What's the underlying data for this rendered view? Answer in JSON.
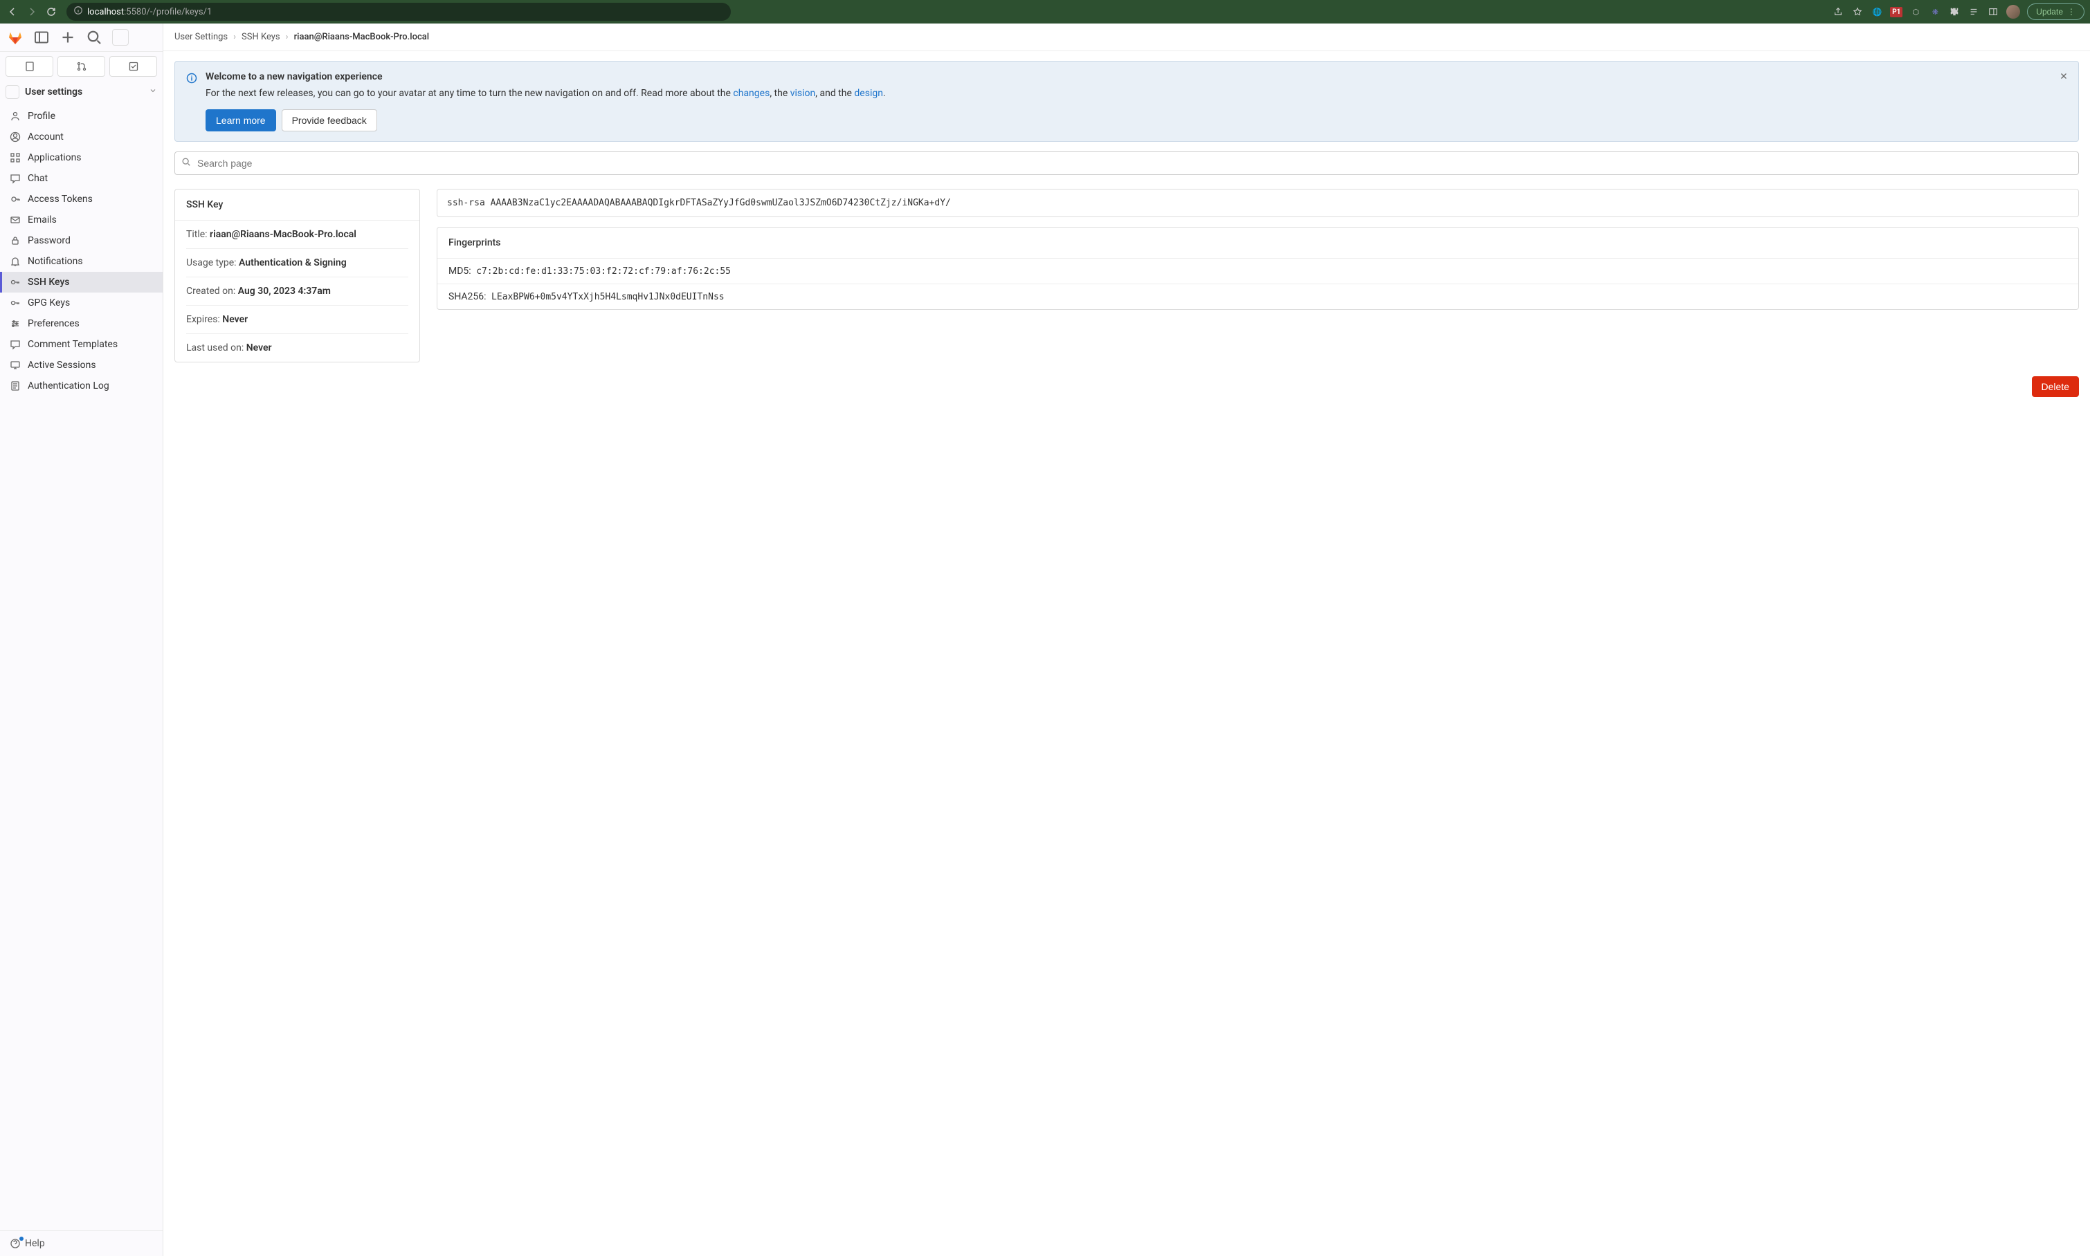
{
  "browser": {
    "url_host": "localhost",
    "url_port_path": ":5580/-/profile/keys/1",
    "update_label": "Update"
  },
  "sidebar": {
    "section_title": "User settings",
    "items": [
      {
        "icon": "profile",
        "label": "Profile"
      },
      {
        "icon": "account",
        "label": "Account"
      },
      {
        "icon": "applications",
        "label": "Applications"
      },
      {
        "icon": "chat",
        "label": "Chat"
      },
      {
        "icon": "token",
        "label": "Access Tokens"
      },
      {
        "icon": "emails",
        "label": "Emails"
      },
      {
        "icon": "password",
        "label": "Password"
      },
      {
        "icon": "notifications",
        "label": "Notifications"
      },
      {
        "icon": "ssh",
        "label": "SSH Keys"
      },
      {
        "icon": "gpg",
        "label": "GPG Keys"
      },
      {
        "icon": "preferences",
        "label": "Preferences"
      },
      {
        "icon": "comment",
        "label": "Comment Templates"
      },
      {
        "icon": "sessions",
        "label": "Active Sessions"
      },
      {
        "icon": "authlog",
        "label": "Authentication Log"
      }
    ],
    "active_index": 8,
    "help_label": "Help"
  },
  "breadcrumb": {
    "items": [
      "User Settings",
      "SSH Keys",
      "riaan@Riaans-MacBook-Pro.local"
    ]
  },
  "banner": {
    "title": "Welcome to a new navigation experience",
    "text_prefix": "For the next few releases, you can go to your avatar at any time to turn the new navigation on and off. Read more about the ",
    "link_changes": "changes",
    "text_mid1": ", the ",
    "link_vision": "vision",
    "text_mid2": ", and the ",
    "link_design": "design",
    "text_suffix": ".",
    "learn_more": "Learn more",
    "feedback": "Provide feedback"
  },
  "search": {
    "placeholder": "Search page"
  },
  "ssh_key": {
    "card_title": "SSH Key",
    "title_label": "Title: ",
    "title_value": "riaan@Riaans-MacBook-Pro.local",
    "usage_label": "Usage type: ",
    "usage_value": "Authentication & Signing",
    "created_label": "Created on: ",
    "created_value": "Aug 30, 2023 4:37am",
    "expires_label": "Expires: ",
    "expires_value": "Never",
    "lastused_label": "Last used on: ",
    "lastused_value": "Never",
    "key_text": "ssh-rsa AAAAB3NzaC1yc2EAAAADAQABAAABAQDIgkrDFTASaZYyJfGd0swmUZaol3JSZmO6D74230CtZjz/iNGKa+dY/",
    "fingerprints_title": "Fingerprints",
    "md5_label": "MD5:",
    "md5_value": "c7:2b:cd:fe:d1:33:75:03:f2:72:cf:79:af:76:2c:55",
    "sha256_label": "SHA256:",
    "sha256_value": "LEaxBPW6+0m5v4YTxXjh5H4LsmqHv1JNx0dEUITnNss",
    "delete_label": "Delete"
  }
}
